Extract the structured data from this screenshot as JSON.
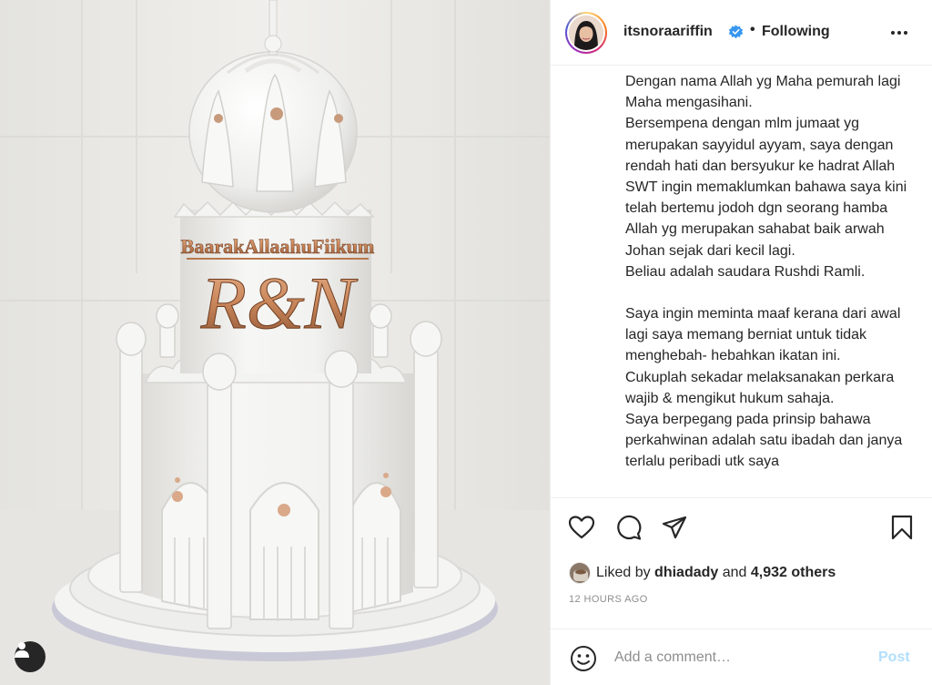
{
  "post_image": {
    "topper_line1": "BaarakAllaahuFiikum",
    "topper_line2": "R&N"
  },
  "header": {
    "username": "itsnoraariffin",
    "follow_status": "Following",
    "separator": "•"
  },
  "caption": {
    "paragraphs": [
      "Dengan nama Allah yg Maha pemurah lagi Maha mengasihani.",
      "Bersempena dengan mlm jumaat yg merupakan sayyidul ayyam, saya dengan rendah hati dan bersyukur ke hadrat Allah SWT ingin memaklumkan bahawa saya kini telah bertemu jodoh dgn seorang hamba Allah yg merupakan sahabat baik arwah Johan sejak dari kecil lagi.",
      "Beliau adalah saudara Rushdi Ramli.",
      "Saya ingin meminta maaf kerana dari awal lagi saya memang berniat untuk tidak menghebah- hebahkan ikatan ini.",
      "Cukuplah sekadar melaksanakan perkara wajib & mengikut hukum sahaja.",
      "Saya berpegang pada prinsip bahawa perkahwinan adalah satu ibadah dan janya terlalu peribadi utk saya"
    ]
  },
  "likes": {
    "prefix": "Liked by",
    "liker": "dhiadady",
    "conjunction": "and",
    "others": "4,932 others"
  },
  "timestamp": "12 HOURS AGO",
  "comment": {
    "placeholder": "Add a comment…",
    "post_label": "Post"
  },
  "icons": {
    "like": "heart-icon",
    "comment": "comment-icon",
    "share": "paper-plane-icon",
    "save": "bookmark-icon",
    "emoji": "smiley-icon",
    "more": "more-options-icon",
    "verified": "verified-badge-icon",
    "profile": "user-profile-icon"
  },
  "colors": {
    "text": "#262626",
    "muted": "#8e8e8e",
    "verified_blue": "#3897f0",
    "post_disabled": "#b2dffc",
    "border": "#efefef",
    "topper_gold": "#c9865a"
  }
}
